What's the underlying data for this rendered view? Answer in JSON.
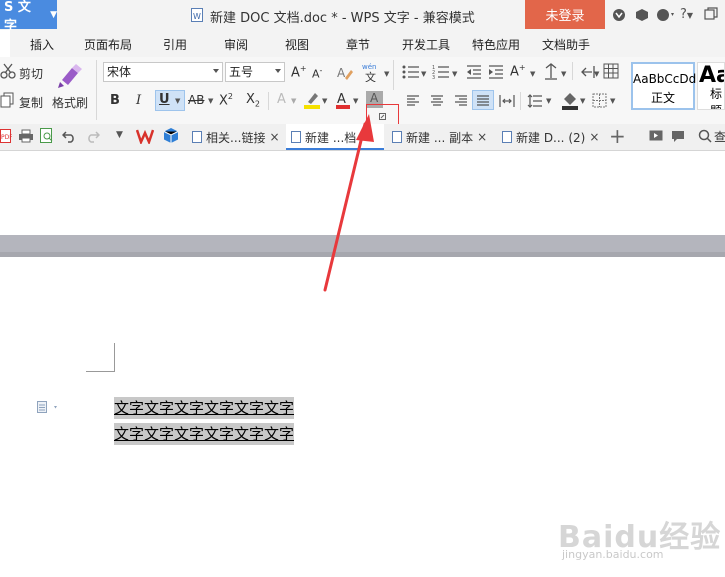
{
  "app": {
    "name": "S 文字"
  },
  "window": {
    "title": "新建 DOC 文档.doc * - WPS 文字 - 兼容模式",
    "login_label": "未登录"
  },
  "menu": [
    "插入",
    "页面布局",
    "引用",
    "审阅",
    "视图",
    "章节",
    "开发工具",
    "特色应用",
    "文档助手"
  ],
  "ribbon": {
    "cut_label": "剪切",
    "copy_label": "复制",
    "format_painter_label": "格式刷",
    "font_name": "宋体",
    "font_size": "五号",
    "styles": {
      "normal_preview": "AaBbCcDd",
      "normal_label": "正文",
      "heading_preview": "Aa",
      "heading_label": "标题"
    }
  },
  "tabs": [
    "相关...链接",
    "新建 ...档",
    "新建 ... 副本",
    "新建 D... (2)"
  ],
  "document": {
    "lines": [
      "文字文字文字文字文字文字",
      "文字文字文字文字文字文字"
    ]
  },
  "watermark": {
    "main": "Baidu经验",
    "sub": "jingyan.baidu.com"
  },
  "colors": {
    "accent": "#4a8be0",
    "login": "#e2664a",
    "arrow": "#e8393c",
    "highlight": "#c8c8c8"
  }
}
